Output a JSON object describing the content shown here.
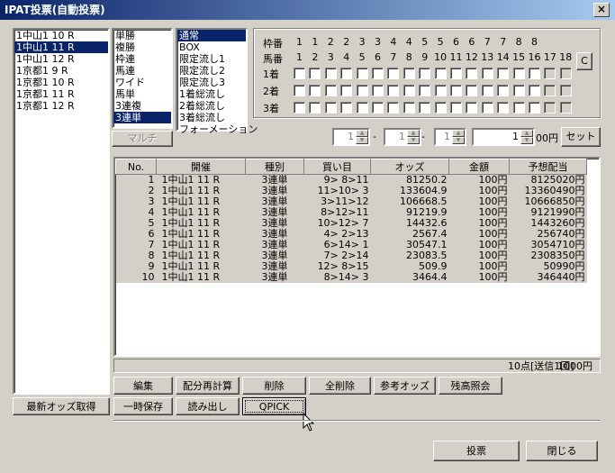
{
  "window": {
    "title": "IPAT投票(自動投票)",
    "close_label": "×"
  },
  "races": [
    {
      "label": "1中山1  10 R",
      "selected": false
    },
    {
      "label": "1中山1  11 R",
      "selected": true
    },
    {
      "label": "1中山1  12 R",
      "selected": false
    },
    {
      "label": "1京都1   9 R",
      "selected": false
    },
    {
      "label": "1京都1  10 R",
      "selected": false
    },
    {
      "label": "1京都1  11 R",
      "selected": false
    },
    {
      "label": "1京都1  12 R",
      "selected": false
    }
  ],
  "bet_types": [
    {
      "label": "単勝",
      "selected": false
    },
    {
      "label": "複勝",
      "selected": false
    },
    {
      "label": "枠連",
      "selected": false
    },
    {
      "label": "馬連",
      "selected": false
    },
    {
      "label": "ワイド",
      "selected": false
    },
    {
      "label": "馬単",
      "selected": false
    },
    {
      "label": "3連複",
      "selected": false
    },
    {
      "label": "3連単",
      "selected": true
    }
  ],
  "methods": [
    {
      "label": "通常",
      "selected": true
    },
    {
      "label": "BOX",
      "selected": false
    },
    {
      "label": "限定流し1",
      "selected": false
    },
    {
      "label": "限定流し2",
      "selected": false
    },
    {
      "label": "限定流し3",
      "selected": false
    },
    {
      "label": "1着総流し",
      "selected": false
    },
    {
      "label": "2着総流し",
      "selected": false
    },
    {
      "label": "3着総流し",
      "selected": false
    },
    {
      "label": "フォーメーション",
      "selected": false
    }
  ],
  "multi_label": "マルチ",
  "grid": {
    "waku_label": "枠番",
    "uma_label": "馬番",
    "waku_numbers": [
      "1",
      "1",
      "2",
      "2",
      "3",
      "3",
      "4",
      "4",
      "5",
      "5",
      "6",
      "6",
      "7",
      "7",
      "8",
      "8"
    ],
    "uma_numbers": [
      "1",
      "2",
      "3",
      "4",
      "5",
      "6",
      "7",
      "8",
      "9",
      "10",
      "11",
      "12",
      "13",
      "14",
      "15",
      "16",
      "17",
      "18"
    ],
    "rows": [
      "1着",
      "2着",
      "3着"
    ],
    "clear_label": "C"
  },
  "amount": {
    "spin1": "1",
    "dash1": "-",
    "spin2": "1",
    "dash2": "-",
    "spin3": "1",
    "value": "1",
    "unit": "00円",
    "set_label": "セット"
  },
  "table": {
    "headers": [
      "No.",
      "開催",
      "種別",
      "買い目",
      "オッズ",
      "金額",
      "予想配当"
    ],
    "rows": [
      [
        "1",
        "1中山1  11 R",
        "3連単",
        "9> 8>11",
        "81250.2",
        "100円",
        "8125020円"
      ],
      [
        "2",
        "1中山1  11 R",
        "3連単",
        "11>10> 3",
        "133604.9",
        "100円",
        "13360490円"
      ],
      [
        "3",
        "1中山1  11 R",
        "3連単",
        "3>11>12",
        "106668.5",
        "100円",
        "10666850円"
      ],
      [
        "4",
        "1中山1  11 R",
        "3連単",
        "8>12>11",
        "91219.9",
        "100円",
        "9121990円"
      ],
      [
        "5",
        "1中山1  11 R",
        "3連単",
        "10>12> 7",
        "14432.6",
        "100円",
        "1443260円"
      ],
      [
        "6",
        "1中山1  11 R",
        "3連単",
        "4> 2>13",
        "2567.4",
        "100円",
        "256740円"
      ],
      [
        "7",
        "1中山1  11 R",
        "3連単",
        "6>14> 1",
        "30547.1",
        "100円",
        "3054710円"
      ],
      [
        "8",
        "1中山1  11 R",
        "3連単",
        "7> 2>14",
        "23083.5",
        "100円",
        "2308350円"
      ],
      [
        "9",
        "1中山1  11 R",
        "3連単",
        "12> 8>15",
        "509.9",
        "100円",
        "50990円"
      ],
      [
        "10",
        "1中山1  11 R",
        "3連単",
        "8>14> 3",
        "3464.4",
        "100円",
        "346440円"
      ]
    ]
  },
  "status": {
    "count": "10点[送信1回]",
    "total": "1000円"
  },
  "buttons": {
    "edit": "編集",
    "recalc": "配分再計算",
    "delete": "削除",
    "delete_all": "全削除",
    "ref_odds": "参考オッズ",
    "balance": "残高照会",
    "latest_odds": "最新オッズ取得",
    "temp_save": "一時保存",
    "load": "読み出し",
    "qpick": "QPICK",
    "vote": "投票",
    "close": "閉じる"
  }
}
